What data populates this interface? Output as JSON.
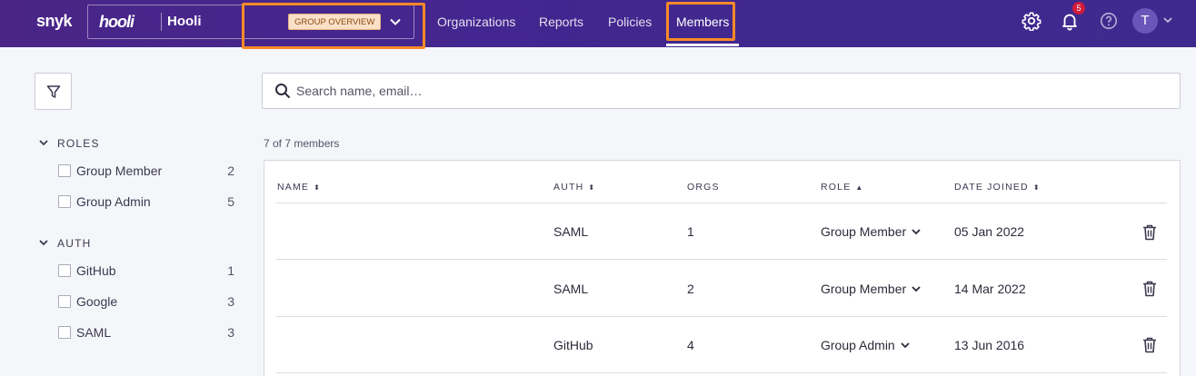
{
  "topnav": {
    "brand": "snyk",
    "group_logo": "hooli",
    "group_name": "Hooli",
    "group_badge": "GROUP OVERVIEW",
    "links": [
      "Organizations",
      "Reports",
      "Policies",
      "Members"
    ],
    "active_link": "Members",
    "notification_count": "5",
    "avatar_initial": "T",
    "highlight_color": "#f78a27"
  },
  "sidebar": {
    "facets": [
      {
        "title": "ROLES",
        "items": [
          {
            "label": "Group Member",
            "count": "2"
          },
          {
            "label": "Group Admin",
            "count": "5"
          }
        ]
      },
      {
        "title": "AUTH",
        "items": [
          {
            "label": "GitHub",
            "count": "1"
          },
          {
            "label": "Google",
            "count": "3"
          },
          {
            "label": "SAML",
            "count": "3"
          }
        ]
      }
    ]
  },
  "search": {
    "placeholder": "Search name, email…"
  },
  "members": {
    "count_text": "7 of 7 members",
    "columns": [
      "NAME",
      "AUTH",
      "ORGS",
      "ROLE",
      "DATE JOINED"
    ],
    "rows": [
      {
        "name": "",
        "auth": "SAML",
        "orgs": "1",
        "role": "Group Member",
        "date_joined": "05 Jan 2022"
      },
      {
        "name": "",
        "auth": "SAML",
        "orgs": "2",
        "role": "Group Member",
        "date_joined": "14 Mar 2022"
      },
      {
        "name": "",
        "auth": "GitHub",
        "orgs": "4",
        "role": "Group Admin",
        "date_joined": "13 Jun 2016"
      }
    ]
  }
}
